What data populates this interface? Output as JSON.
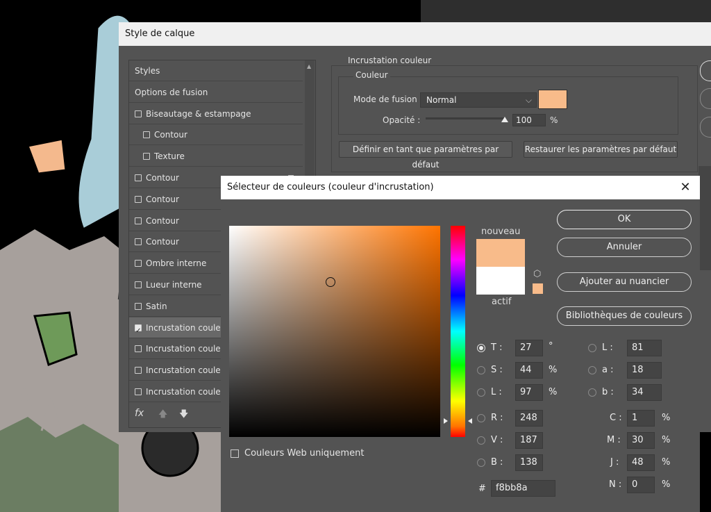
{
  "layer_style": {
    "title": "Style de calque",
    "styles_list": [
      {
        "label": "Styles",
        "checkbox": false,
        "checked": false,
        "indent": 0,
        "add": false
      },
      {
        "label": "Options de fusion",
        "checkbox": false,
        "checked": false,
        "indent": 0,
        "add": false
      },
      {
        "label": "Biseautage & estampage",
        "checkbox": true,
        "checked": false,
        "indent": 0,
        "add": false
      },
      {
        "label": "Contour",
        "checkbox": true,
        "checked": false,
        "indent": 1,
        "add": false
      },
      {
        "label": "Texture",
        "checkbox": true,
        "checked": false,
        "indent": 1,
        "add": false
      },
      {
        "label": "Contour",
        "checkbox": true,
        "checked": false,
        "indent": 0,
        "add": true
      },
      {
        "label": "Contour",
        "checkbox": true,
        "checked": false,
        "indent": 0,
        "add": false
      },
      {
        "label": "Contour",
        "checkbox": true,
        "checked": false,
        "indent": 0,
        "add": false
      },
      {
        "label": "Contour",
        "checkbox": true,
        "checked": false,
        "indent": 0,
        "add": false
      },
      {
        "label": "Ombre interne",
        "checkbox": true,
        "checked": false,
        "indent": 0,
        "add": false
      },
      {
        "label": "Lueur interne",
        "checkbox": true,
        "checked": false,
        "indent": 0,
        "add": false
      },
      {
        "label": "Satin",
        "checkbox": true,
        "checked": false,
        "indent": 0,
        "add": false
      },
      {
        "label": "Incrustation couleur",
        "checkbox": true,
        "checked": true,
        "indent": 0,
        "add": false
      },
      {
        "label": "Incrustation couleur",
        "checkbox": true,
        "checked": false,
        "indent": 0,
        "add": false
      },
      {
        "label": "Incrustation couleur",
        "checkbox": true,
        "checked": false,
        "indent": 0,
        "add": false
      },
      {
        "label": "Incrustation couleur",
        "checkbox": true,
        "checked": false,
        "indent": 0,
        "add": false
      }
    ],
    "fx_label": "fx",
    "section_title": "Incrustation couleur",
    "group_title": "Couleur",
    "blend_mode_label": "Mode de fusion :",
    "blend_mode_value": "Normal",
    "overlay_color": "#f8bb8a",
    "opacity_label": "Opacité :",
    "opacity_value": "100",
    "opacity_unit": "%",
    "opacity_fraction": 1.0,
    "set_default_label": "Définir en tant que paramètres par défaut",
    "reset_default_label": "Restaurer les paramètres par défaut"
  },
  "color_picker": {
    "title": "Sélecteur de couleurs (couleur d'incrustation)",
    "new_label": "nouveau",
    "current_label": "actif",
    "new_color": "#f8bb8a",
    "current_color": "#ffffff",
    "hue_color": "#ff7400",
    "ok_label": "OK",
    "cancel_label": "Annuler",
    "add_swatch_label": "Ajouter au nuancier",
    "libraries_label": "Bibliothèques de couleurs",
    "web_only_label": "Couleurs Web uniquement",
    "hsb": {
      "h_label": "T :",
      "h": "27",
      "h_unit": "°",
      "s_label": "S :",
      "s": "44",
      "s_unit": "%",
      "b_label": "L :",
      "b": "97",
      "b_unit": "%"
    },
    "rgb": {
      "r_label": "R :",
      "r": "248",
      "g_label": "V :",
      "g": "187",
      "b_label": "B :",
      "b": "138"
    },
    "lab": {
      "l_label": "L :",
      "l": "81",
      "a_label": "a :",
      "a": "18",
      "b_label": "b :",
      "b": "34"
    },
    "cmyk": {
      "c_label": "C :",
      "c": "1",
      "m_label": "M :",
      "m": "30",
      "y_label": "J :",
      "y": "48",
      "k_label": "N :",
      "k": "0",
      "unit": "%"
    },
    "hex_label": "#",
    "hex": "f8bb8a"
  }
}
